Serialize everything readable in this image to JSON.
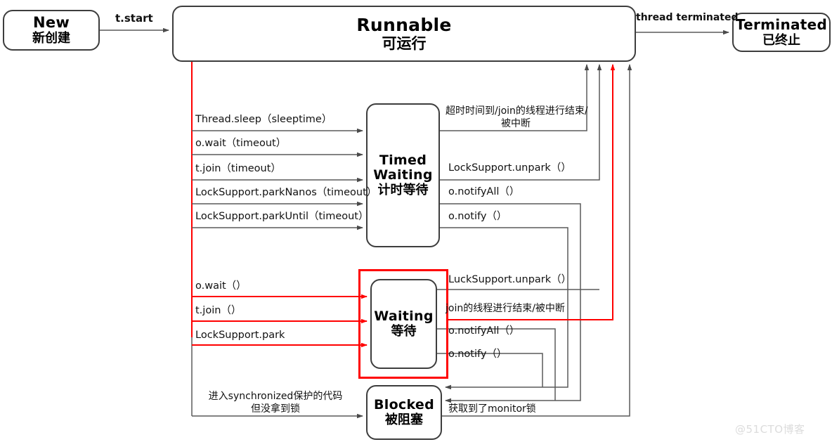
{
  "diagram": {
    "title": "Java Thread State Transition Diagram",
    "watermark": "@51CTO博客",
    "colors": {
      "stroke": "#5a5a5a",
      "node_border": "#3d3d3d",
      "highlight": "#ff0000",
      "text": "#111111"
    }
  },
  "nodes": {
    "new": {
      "en": "New",
      "cn": "新创建"
    },
    "runnable": {
      "en": "Runnable",
      "cn": "可运行"
    },
    "terminated": {
      "en": "Terminated",
      "cn": "已终止"
    },
    "timed": {
      "en": "Timed",
      "en2": "Waiting",
      "cn": "计时等待"
    },
    "waiting": {
      "en": "Waiting",
      "cn": "等待"
    },
    "blocked": {
      "en": "Blocked",
      "cn": "被阻塞"
    }
  },
  "edges": {
    "start": "t.start",
    "thread_terminated": "thread terminated",
    "to_timed": [
      "Thread.sleep（sleeptime）",
      "o.wait（timeout）",
      "t.join（timeout）",
      "LockSupport.parkNanos（timeout）",
      "LockSupport.parkUntil（timeout）"
    ],
    "from_timed": [
      {
        "line1": "超时时间到/join的线程进行结束/",
        "line2": "被中断"
      },
      {
        "line1": "LockSupport.unpark（）"
      },
      {
        "line1": "o.notifyAll（）"
      },
      {
        "line1": "o.notify（）"
      }
    ],
    "to_waiting": [
      "o.wait（）",
      "t.join（）",
      "LockSupport.park"
    ],
    "from_waiting": [
      "LuckSupport.unpark（）",
      "join的线程进行结束/被中断",
      "o.notifyAll（）",
      "o.notify（）"
    ],
    "to_blocked": {
      "line1": "进入synchronized保护的代码",
      "line2": "但没拿到锁"
    },
    "from_blocked": "获取到了monitor锁"
  }
}
